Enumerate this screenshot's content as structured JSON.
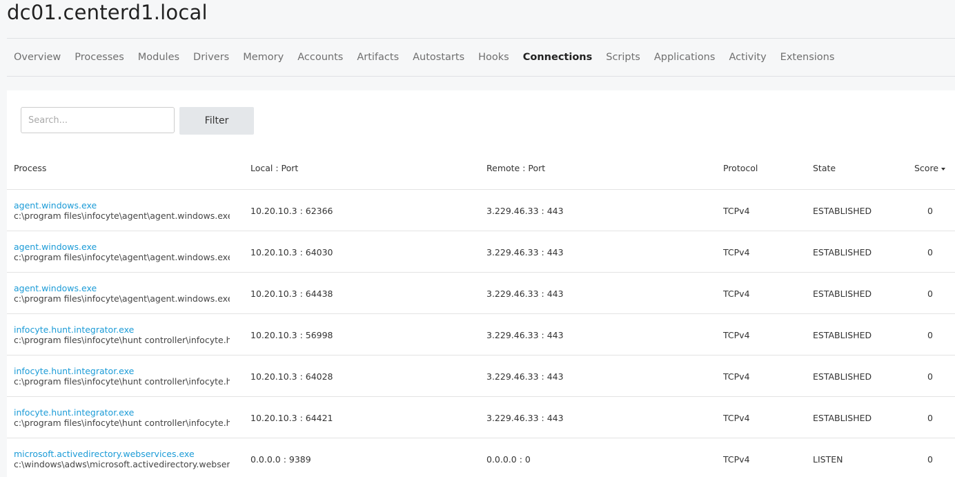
{
  "page_title": "dc01.centerd1.local",
  "tabs": [
    {
      "label": "Overview",
      "active": false
    },
    {
      "label": "Processes",
      "active": false
    },
    {
      "label": "Modules",
      "active": false
    },
    {
      "label": "Drivers",
      "active": false
    },
    {
      "label": "Memory",
      "active": false
    },
    {
      "label": "Accounts",
      "active": false
    },
    {
      "label": "Artifacts",
      "active": false
    },
    {
      "label": "Autostarts",
      "active": false
    },
    {
      "label": "Hooks",
      "active": false
    },
    {
      "label": "Connections",
      "active": true
    },
    {
      "label": "Scripts",
      "active": false
    },
    {
      "label": "Applications",
      "active": false
    },
    {
      "label": "Activity",
      "active": false
    },
    {
      "label": "Extensions",
      "active": false
    }
  ],
  "search": {
    "placeholder": "Search...",
    "value": ""
  },
  "filter_label": "Filter",
  "columns": {
    "process": "Process",
    "local": "Local : Port",
    "remote": "Remote : Port",
    "protocol": "Protocol",
    "state": "State",
    "score": "Score"
  },
  "sort_indicator": "caret-down-icon",
  "link_color": "#1b9bd7",
  "rows": [
    {
      "process": "agent.windows.exe",
      "path": "c:\\program files\\infocyte\\agent\\agent.windows.exe",
      "local": "10.20.10.3 : 62366",
      "remote": "3.229.46.33 : 443",
      "protocol": "TCPv4",
      "state": "ESTABLISHED",
      "score": "0"
    },
    {
      "process": "agent.windows.exe",
      "path": "c:\\program files\\infocyte\\agent\\agent.windows.exe",
      "local": "10.20.10.3 : 64030",
      "remote": "3.229.46.33 : 443",
      "protocol": "TCPv4",
      "state": "ESTABLISHED",
      "score": "0"
    },
    {
      "process": "agent.windows.exe",
      "path": "c:\\program files\\infocyte\\agent\\agent.windows.exe",
      "local": "10.20.10.3 : 64438",
      "remote": "3.229.46.33 : 443",
      "protocol": "TCPv4",
      "state": "ESTABLISHED",
      "score": "0"
    },
    {
      "process": "infocyte.hunt.integrator.exe",
      "path": "c:\\program files\\infocyte\\hunt controller\\infocyte.hu",
      "local": "10.20.10.3 : 56998",
      "remote": "3.229.46.33 : 443",
      "protocol": "TCPv4",
      "state": "ESTABLISHED",
      "score": "0"
    },
    {
      "process": "infocyte.hunt.integrator.exe",
      "path": "c:\\program files\\infocyte\\hunt controller\\infocyte.hu",
      "local": "10.20.10.3 : 64028",
      "remote": "3.229.46.33 : 443",
      "protocol": "TCPv4",
      "state": "ESTABLISHED",
      "score": "0"
    },
    {
      "process": "infocyte.hunt.integrator.exe",
      "path": "c:\\program files\\infocyte\\hunt controller\\infocyte.hu",
      "local": "10.20.10.3 : 64421",
      "remote": "3.229.46.33 : 443",
      "protocol": "TCPv4",
      "state": "ESTABLISHED",
      "score": "0"
    },
    {
      "process": "microsoft.activedirectory.webservices.exe",
      "path": "c:\\windows\\adws\\microsoft.activedirectory.webserv",
      "local": "0.0.0.0 : 9389",
      "remote": "0.0.0.0 : 0",
      "protocol": "TCPv4",
      "state": "LISTEN",
      "score": "0"
    }
  ]
}
